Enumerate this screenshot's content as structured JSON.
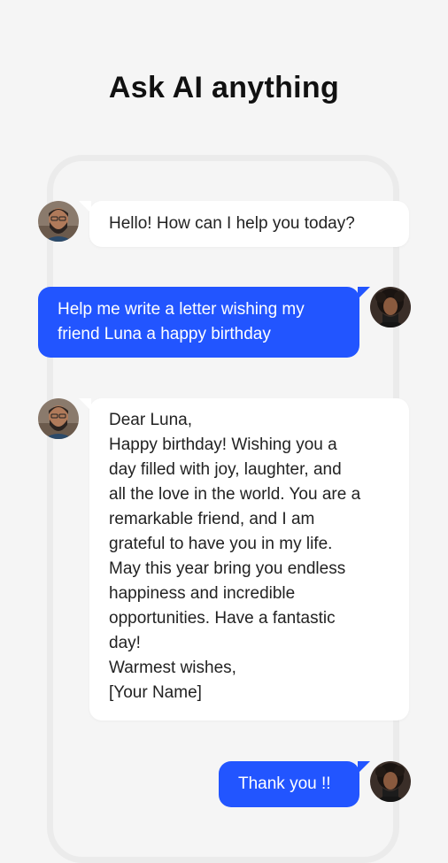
{
  "headline": "Ask AI anything",
  "messages": [
    {
      "role": "ai",
      "lines": [
        "Hello! How can I help you today?"
      ]
    },
    {
      "role": "user",
      "lines": [
        "Help me write a letter wishing my",
        "friend Luna a happy birthday"
      ]
    },
    {
      "role": "ai",
      "lines": [
        "Dear Luna,",
        "Happy birthday! Wishing you a",
        "day filled with joy, laughter, and",
        "all the love in the world. You are a",
        "remarkable friend, and I am",
        "grateful to have you in my life.",
        "May this year bring you endless",
        "happiness and incredible",
        "opportunities. Have a fantastic",
        "day!",
        "Warmest wishes,",
        "[Your Name]"
      ]
    },
    {
      "role": "user",
      "lines": [
        "Thank you !!"
      ]
    }
  ],
  "colors": {
    "user_bubble": "#2255ff",
    "ai_bubble": "#ffffff",
    "background": "#f5f5f5"
  },
  "icons": {
    "ai_avatar": "bearded-man-avatar",
    "user_avatar": "curly-hair-person-avatar"
  }
}
